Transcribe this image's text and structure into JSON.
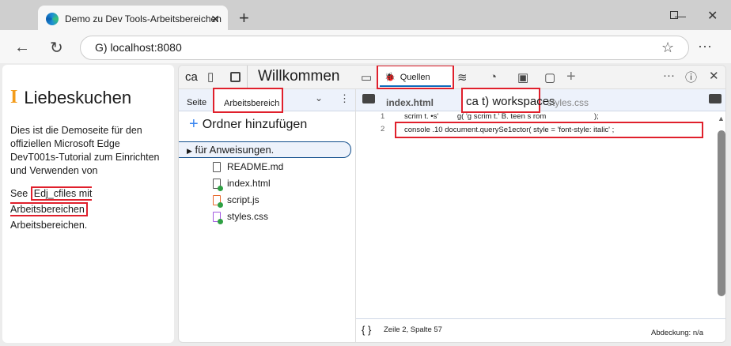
{
  "browser": {
    "tab_title": "Demo zu Dev Tools-Arbeitsbereichen",
    "address": "G) localhost:8080"
  },
  "page": {
    "heading_icon": "I",
    "heading": "Liebeskuchen",
    "paragraph": "Dies ist die Demoseite für den offiziellen Microsoft Edge DevT001s-Tutorial zum Einrichten und Verwenden von",
    "see_prefix": "See",
    "link": "Edj_cfiles mit Arbeitsbereichen",
    "see_suffix": "Arbeitsbereichen."
  },
  "devtools": {
    "toolbar": {
      "ca": "ca",
      "welcome": "Willkommen",
      "sources_tab": "Quellen"
    },
    "left": {
      "tab_page": "Seite",
      "tab_workspace": "Arbeitsbereich",
      "add_folder": "Ordner hinzufügen",
      "folder": "für Anweisungen.",
      "files": [
        {
          "name": "README.md",
          "color": "#555",
          "dot": false
        },
        {
          "name": "index.html",
          "color": "#555",
          "dot": true
        },
        {
          "name": "script.js",
          "color": "#e8692c",
          "dot": true
        },
        {
          "name": "styles.css",
          "color": "#a259e0",
          "dot": true
        }
      ]
    },
    "editor": {
      "tabs": [
        "index.html",
        "ca t) workspaces",
        "styles.css"
      ],
      "lines": [
        {
          "num": "1",
          "text": "scrim t. •s'         g( 'g scrim t.' B. teen s rom                       );"
        },
        {
          "num": "2",
          "text": "console .10 document.querySe1ector( style = 'font-style: italic' ;"
        }
      ]
    },
    "status": {
      "braces": "{ }",
      "position": "Zeile 2, Spalte 57",
      "coverage": "Abdeckung: n/a"
    }
  }
}
